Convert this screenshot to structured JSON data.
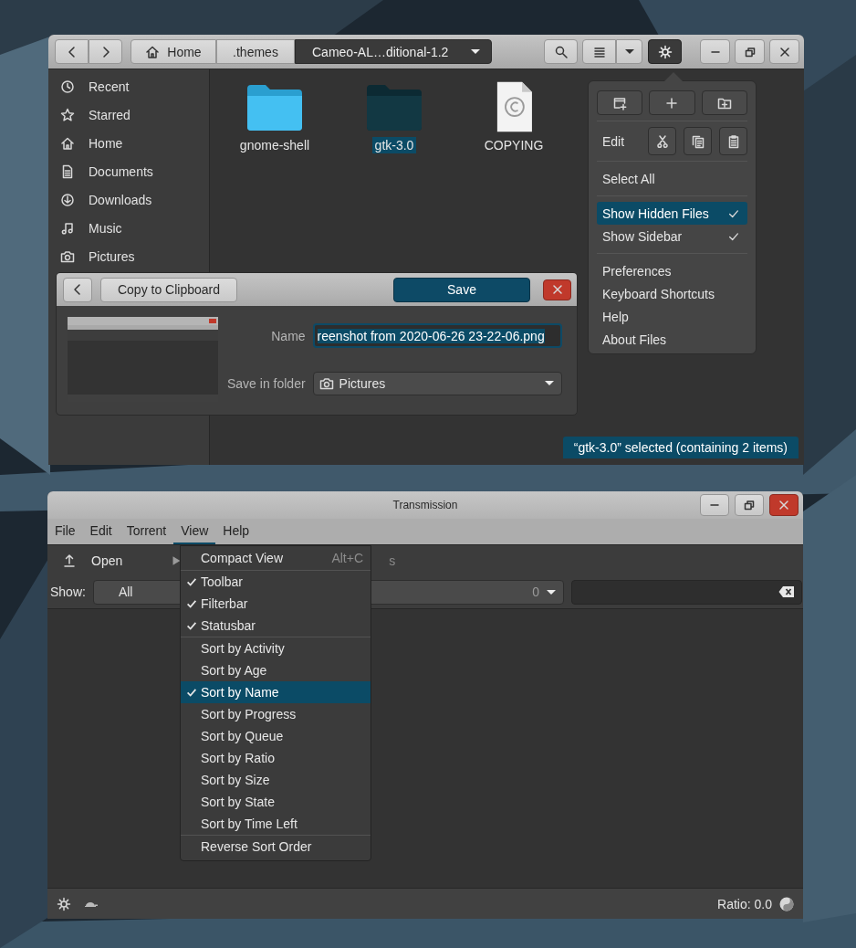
{
  "files_window": {
    "path": [
      {
        "label": "Home",
        "kind": "home",
        "selected": false
      },
      {
        "label": ".themes",
        "kind": "plain",
        "selected": false
      },
      {
        "label": "Cameo-AL…ditional-1.2",
        "kind": "plain",
        "selected": true
      }
    ],
    "sidebar": [
      {
        "label": "Recent",
        "kind": "recent"
      },
      {
        "label": "Starred",
        "kind": "starred"
      },
      {
        "label": "Home",
        "kind": "home"
      },
      {
        "label": "Documents",
        "kind": "documents"
      },
      {
        "label": "Downloads",
        "kind": "downloads"
      },
      {
        "label": "Music",
        "kind": "music"
      },
      {
        "label": "Pictures",
        "kind": "pictures"
      }
    ],
    "files": [
      {
        "name": "gnome-shell",
        "kind": "folder",
        "selected": false
      },
      {
        "name": "gtk-3.0",
        "kind": "folder",
        "selected": true
      },
      {
        "name": "COPYING",
        "kind": "document",
        "selected": false
      }
    ],
    "status": "“gtk-3.0” selected (containing 2 items)"
  },
  "popover": {
    "edit_label": "Edit",
    "groups": [
      [
        {
          "label": "Select All",
          "checked": false,
          "selected": false
        }
      ],
      [
        {
          "label": "Show Hidden Files",
          "checked": true,
          "selected": true
        },
        {
          "label": "Show Sidebar",
          "checked": true,
          "selected": false
        }
      ],
      [
        {
          "label": "Preferences",
          "checked": false,
          "selected": false
        },
        {
          "label": "Keyboard Shortcuts",
          "checked": false,
          "selected": false
        },
        {
          "label": "Help",
          "checked": false,
          "selected": false
        },
        {
          "label": "About Files",
          "checked": false,
          "selected": false
        }
      ]
    ]
  },
  "save_dialog": {
    "copy_label": "Copy to Clipboard",
    "save_label": "Save",
    "name_label": "Name",
    "name_value": "reenshot from 2020-06-26 23-22-06.png",
    "folder_label": "Save in folder",
    "folder_value": "Pictures"
  },
  "transmission": {
    "title": "Transmission",
    "menus": [
      {
        "label": "File",
        "selected": false
      },
      {
        "label": "Edit",
        "selected": false
      },
      {
        "label": "Torrent",
        "selected": false
      },
      {
        "label": "View",
        "selected": true
      },
      {
        "label": "Help",
        "selected": false
      }
    ],
    "toolbar": {
      "open_label": "Open",
      "partial_label": "s"
    },
    "filter": {
      "show_label": "Show:",
      "activity": "All",
      "tracker_count": "0"
    },
    "view_menu": [
      [
        {
          "label": "Compact View",
          "shortcut": "Alt+C",
          "checked": false,
          "selected": false
        }
      ],
      [
        {
          "label": "Toolbar",
          "checked": true,
          "selected": false
        },
        {
          "label": "Filterbar",
          "checked": true,
          "selected": false
        },
        {
          "label": "Statusbar",
          "checked": true,
          "selected": false
        }
      ],
      [
        {
          "label": "Sort by Activity",
          "checked": false,
          "selected": false
        },
        {
          "label": "Sort by Age",
          "checked": false,
          "selected": false
        },
        {
          "label": "Sort by Name",
          "checked": true,
          "selected": true
        },
        {
          "label": "Sort by Progress",
          "checked": false,
          "selected": false
        },
        {
          "label": "Sort by Queue",
          "checked": false,
          "selected": false
        },
        {
          "label": "Sort by Ratio",
          "checked": false,
          "selected": false
        },
        {
          "label": "Sort by Size",
          "checked": false,
          "selected": false
        },
        {
          "label": "Sort by State",
          "checked": false,
          "selected": false
        },
        {
          "label": "Sort by Time Left",
          "checked": false,
          "selected": false
        }
      ],
      [
        {
          "label": "Reverse Sort Order",
          "checked": false,
          "selected": false
        }
      ]
    ],
    "ratio": "Ratio: 0.0"
  }
}
